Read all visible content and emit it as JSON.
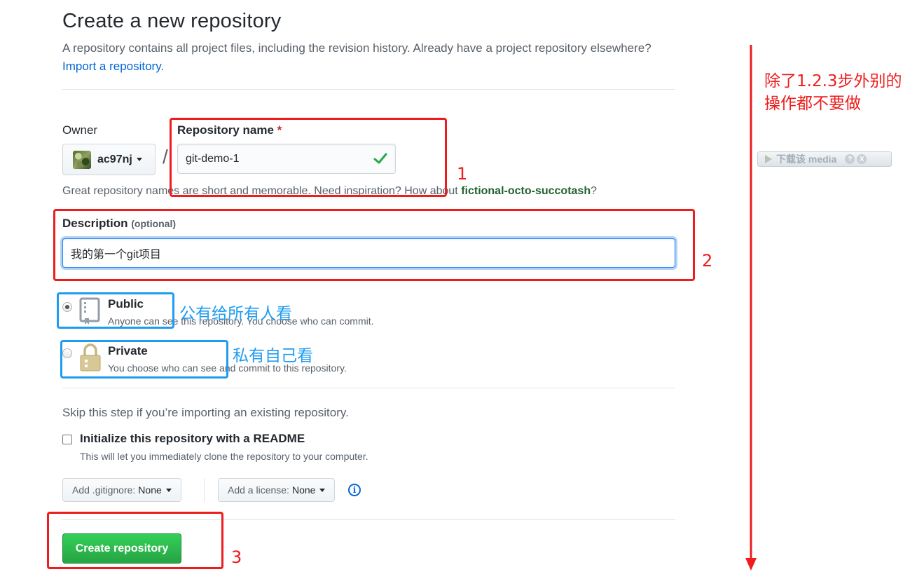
{
  "page": {
    "title": "Create a new repository",
    "lead_text": "A repository contains all project files, including the revision history. Already have a project repository elsewhere?",
    "import_link": "Import a repository."
  },
  "owner": {
    "label": "Owner",
    "value": "ac97nj"
  },
  "repo_name": {
    "label": "Repository name",
    "required_mark": "*",
    "value": "git-demo-1",
    "separator": "/"
  },
  "hint": {
    "text": "Great repository names are short and memorable. Need inspiration? How about ",
    "suggestion": "fictional-octo-succotash",
    "end": "?"
  },
  "description": {
    "label": "Description",
    "optional": "(optional)",
    "value": "我的第一个git项目"
  },
  "visibility": {
    "public": {
      "title": "Public",
      "note": "Anyone can see this repository. You choose who can commit.",
      "selected": true
    },
    "private": {
      "title": "Private",
      "note": "You choose who can see and commit to this repository.",
      "selected": false
    }
  },
  "init": {
    "skip_text": "Skip this step if you’re importing an existing repository.",
    "readme_label": "Initialize this repository with a README",
    "readme_note": "This will let you immediately clone the repository to your computer.",
    "readme_checked": false
  },
  "options": {
    "gitignore_prefix": "Add .gitignore:",
    "gitignore_value": "None",
    "license_prefix": "Add a license:",
    "license_value": "None",
    "info_glyph": "i"
  },
  "create_button": "Create repository",
  "annotations": {
    "num1": "1",
    "num2": "2",
    "num3": "3",
    "public_note": "公有给所有人看",
    "private_note": "私有自己看",
    "side_note_line1": "除了1.2.3步外别的",
    "side_note_line2": "操作都不要做",
    "red_color": "#ee1c1c",
    "blue_color": "#1e9cf0"
  },
  "media_bar": {
    "label": "下载该 media",
    "help": "?",
    "close": "X"
  }
}
